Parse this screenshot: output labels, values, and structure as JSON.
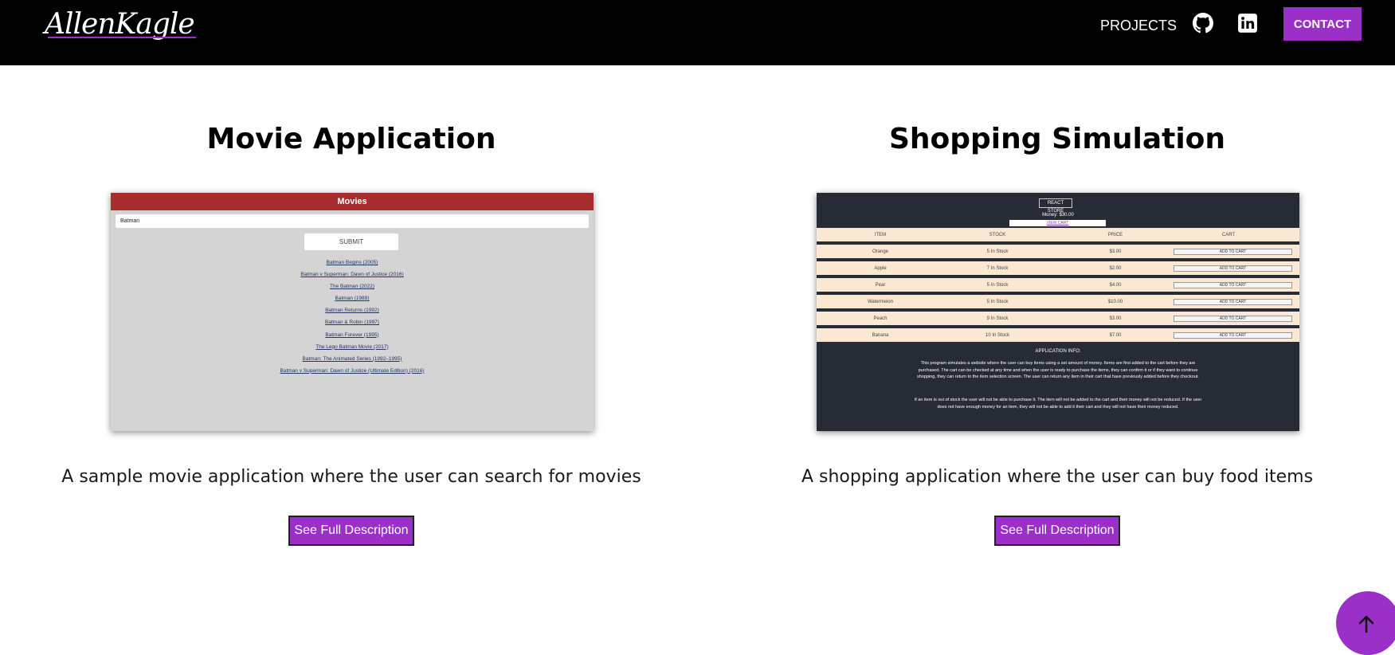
{
  "nav": {
    "logo_text": "AllenKagle",
    "projects_label": "PROJECTS",
    "contact_label": "CONTACT",
    "icons": [
      "github-icon",
      "linkedin-icon"
    ]
  },
  "colors": {
    "accent": "#9b30c9",
    "nav_bg": "#000000"
  },
  "projects": [
    {
      "title": "Movie Application",
      "description": "A sample movie application where the user can search for movies",
      "button_label": "See Full Description",
      "preview": {
        "header": "Movies",
        "input_value": "Batman",
        "submit_label": "SUBMIT",
        "results": [
          "Batman Begins (2005)",
          "Batman v Superman: Dawn of Justice (2016)",
          "The Batman (2022)",
          "Batman (1989)",
          "Batman Returns (1992)",
          "Batman & Robin (1997)",
          "Batman Forever (1995)",
          "The Lego Batman Movie (2017)",
          "Batman: The Animated Series (1992–1995)",
          "Batman v Superman: Dawn of Justice (Ultimate Edition) (2016)"
        ]
      }
    },
    {
      "title": "Shopping Simulation",
      "description": "A shopping application where the user can buy food items",
      "button_label": "See Full Description",
      "preview": {
        "store_title": "REACT STORE",
        "money": "Money: $30.00",
        "view_cart": "VIEW CART",
        "columns": [
          "ITEM",
          "STOCK",
          "PRICE",
          "CART"
        ],
        "rows": [
          {
            "item": "Orange",
            "stock": "5 In Stock",
            "price": "$3.00",
            "cart": "ADD TO CART"
          },
          {
            "item": "Apple",
            "stock": "7 In Stock",
            "price": "$2.00",
            "cart": "ADD TO CART"
          },
          {
            "item": "Pear",
            "stock": "5 In Stock",
            "price": "$4.00",
            "cart": "ADD TO CART"
          },
          {
            "item": "Watermelon",
            "stock": "5 In Stock",
            "price": "$10.00",
            "cart": "ADD TO CART"
          },
          {
            "item": "Peach",
            "stock": "9 In Stock",
            "price": "$3.00",
            "cart": "ADD TO CART"
          },
          {
            "item": "Banana",
            "stock": "10 In Stock",
            "price": "$7.00",
            "cart": "ADD TO CART"
          }
        ],
        "info_heading": "APPLICATION INFO:",
        "info_p1": "This program simulates a website where the user can buy items using a set amount of money. Items are first added to the cart before they are purchased. The cart can be checked at any time and when the user is ready to purchase the items, they can confirm it or if they want to continue shopping, they can return to the item selection screen. The user can return any item in their cart that have previously added before they checkout.",
        "info_p2": "If an item is out of stock the user will not be able to purchase it. The item will not be added to the cart and their money will not be reduced. If the user does not have enough money for an item, they will not be able to add it their cart and they will not have their money reduced."
      }
    }
  ]
}
